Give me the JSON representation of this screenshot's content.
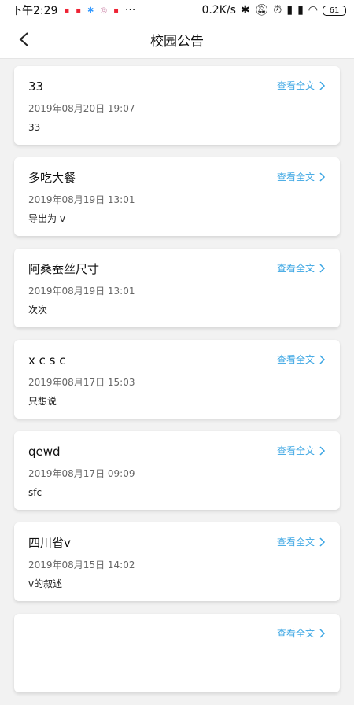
{
  "status_bar": {
    "time": "下午2:29",
    "network_speed": "0.2K/s",
    "battery": "61",
    "icons": [
      "notification-dot",
      "notification-dot",
      "notification-dot",
      "notification-dot",
      "more",
      "bluetooth-icon",
      "mute-icon",
      "alarm-icon",
      "signal-icon",
      "signal-icon",
      "wifi-icon",
      "battery-icon"
    ]
  },
  "header": {
    "title": "校园公告"
  },
  "notices": [
    {
      "title": "33",
      "date": "2019年08月20日 19:07",
      "content": "33",
      "link": "查看全文"
    },
    {
      "title": "多吃大餐",
      "date": "2019年08月19日 13:01",
      "content": "导出为 v",
      "link": "查看全文"
    },
    {
      "title": "阿桑蚕丝尺寸",
      "date": "2019年08月19日 13:01",
      "content": "次次",
      "link": "查看全文"
    },
    {
      "title": "x c s c",
      "date": "2019年08月17日 15:03",
      "content": "只想说",
      "link": "查看全文"
    },
    {
      "title": "qewd",
      "date": "2019年08月17日 09:09",
      "content": "sfc",
      "link": "查看全文"
    },
    {
      "title": "四川省v",
      "date": "2019年08月15日 14:02",
      "content": "v的叙述",
      "link": "查看全文"
    },
    {
      "title": "",
      "date": "",
      "content": "",
      "link": "查看全文"
    }
  ],
  "colors": {
    "accent": "#3aa5e3",
    "background": "#f2f2f2"
  }
}
